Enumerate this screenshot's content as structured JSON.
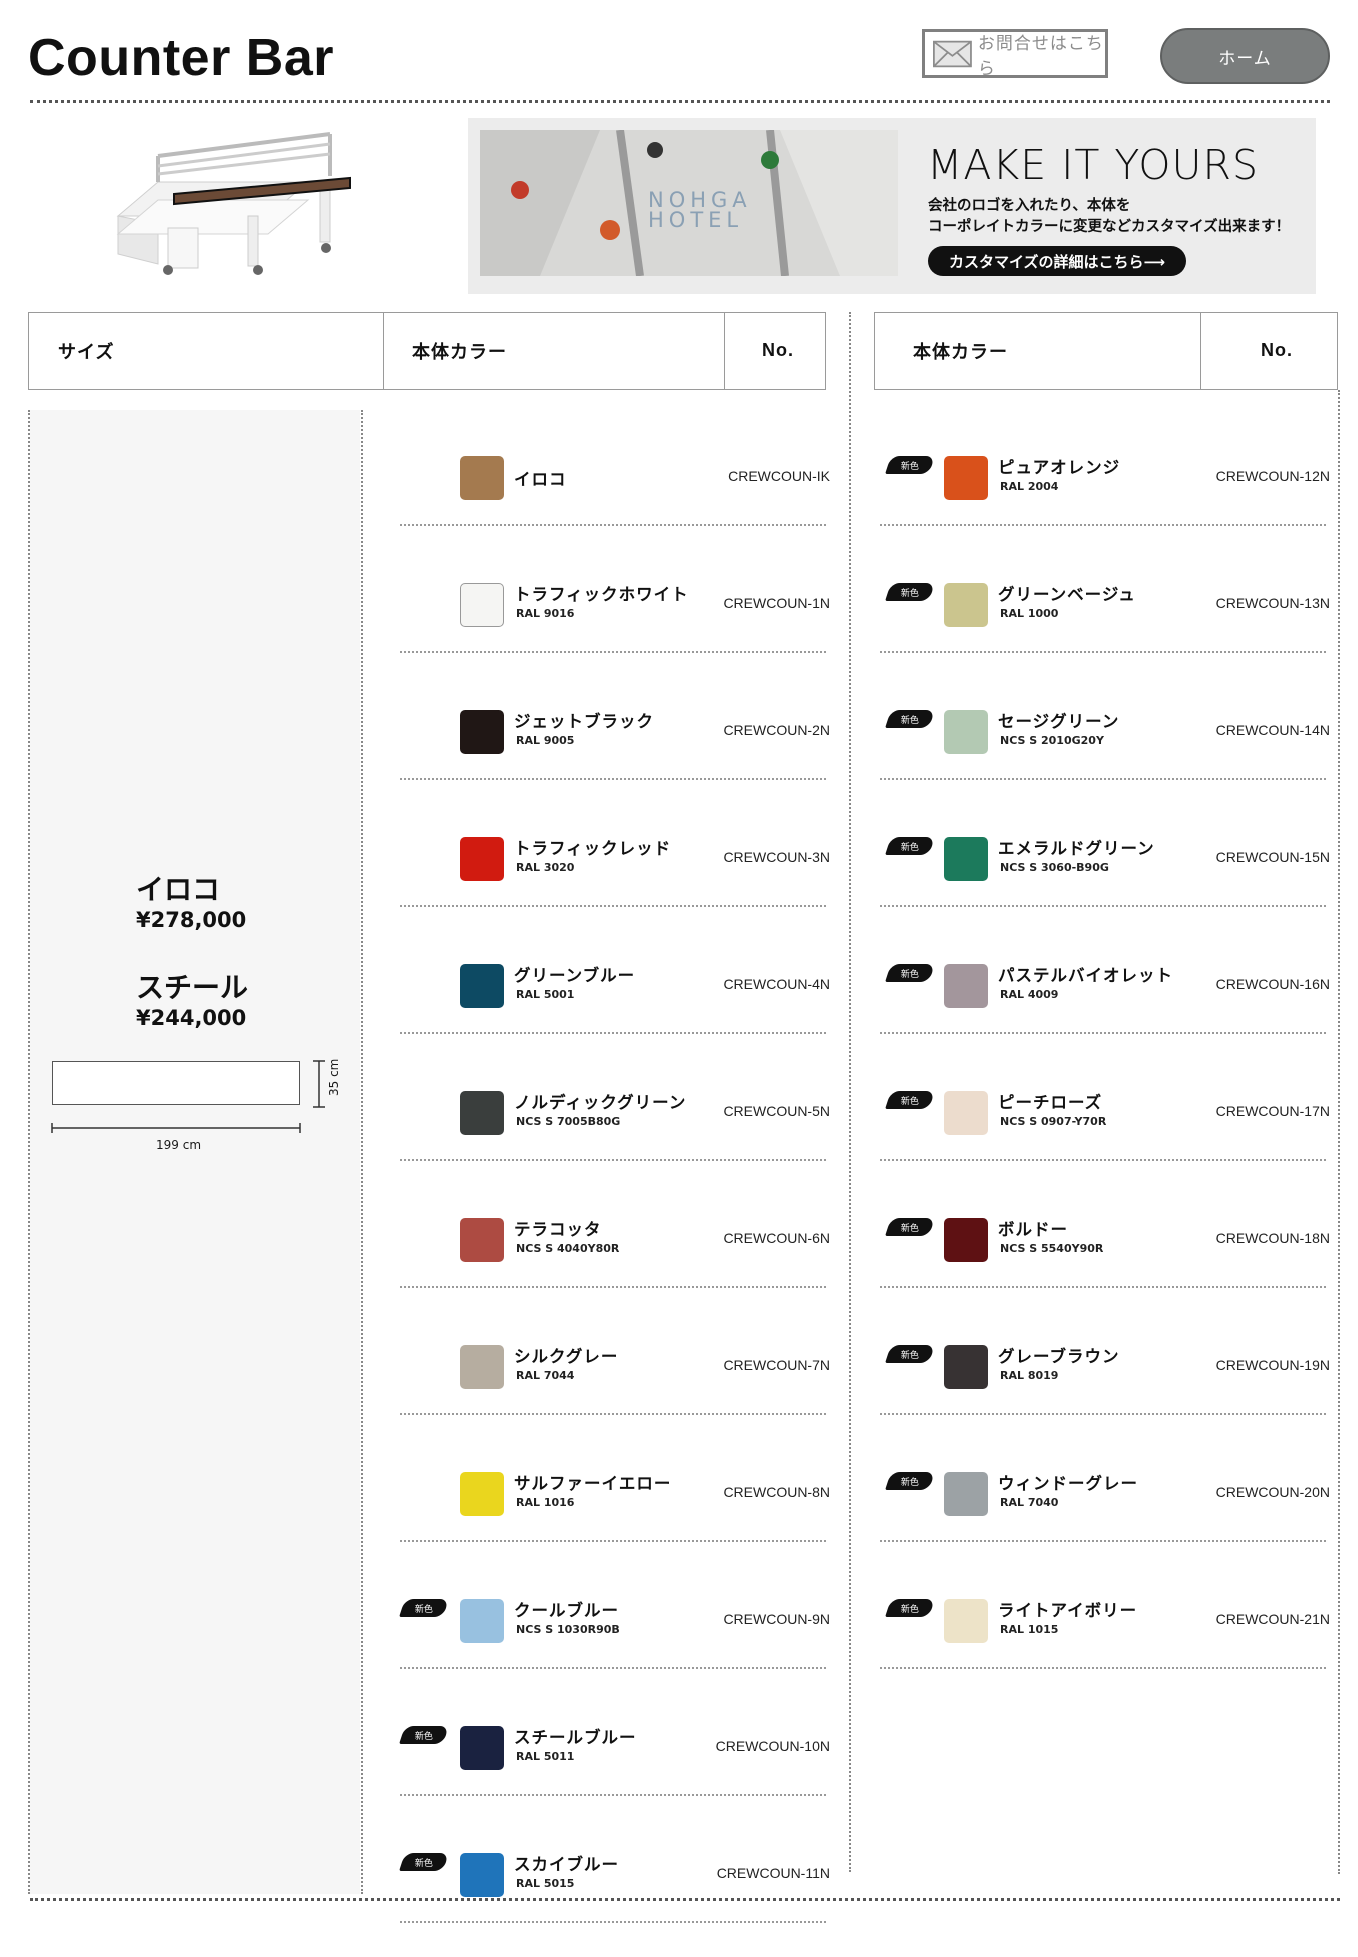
{
  "header": {
    "title": "Counter Bar",
    "contact_label": "お問合せはこちら",
    "home_label": "ホーム"
  },
  "banner": {
    "headline": "MAKE IT YOURS",
    "sub1": "会社のロゴを入れたり、本体を",
    "sub2": "コーポレイトカラーに変更などカスタマイズ出来ます！",
    "cta": "カスタマイズの詳細はこちら⟶",
    "photo_text1": "NOHGA",
    "photo_text2": "HOTEL"
  },
  "table": {
    "size_header": "サイズ",
    "color_header": "本体カラー",
    "no_header": "No.",
    "color_header_right": "本体カラー",
    "no_header_right": "No."
  },
  "sizes": {
    "name1": "イロコ",
    "price1": "¥278,000",
    "name2": "スチール",
    "price2": "¥244,000",
    "depth": "35 cm",
    "width": "199 cm"
  },
  "new_badge": "新色",
  "colors_left": [
    {
      "name": "イロコ",
      "code": "",
      "no": "CREWCOUN-IK",
      "hex": "#a47a4f",
      "is_new": false
    },
    {
      "name": "トラフィックホワイト",
      "code": "RAL 9016",
      "no": "CREWCOUN-1N",
      "hex": "#f5f5f3",
      "is_new": false
    },
    {
      "name": "ジェットブラック",
      "code": "RAL 9005",
      "no": "CREWCOUN-2N",
      "hex": "#201715",
      "is_new": false
    },
    {
      "name": "トラフィックレッド",
      "code": "RAL 3020",
      "no": "CREWCOUN-3N",
      "hex": "#d11b10",
      "is_new": false
    },
    {
      "name": "グリーンブルー",
      "code": "RAL 5001",
      "no": "CREWCOUN-4N",
      "hex": "#0d4a63",
      "is_new": false
    },
    {
      "name": "ノルディックグリーン",
      "code": "NCS S 7005B80G",
      "no": "CREWCOUN-5N",
      "hex": "#3a3e3d",
      "is_new": false
    },
    {
      "name": "テラコッタ",
      "code": "NCS S 4040Y80R",
      "no": "CREWCOUN-6N",
      "hex": "#ad4b42",
      "is_new": false
    },
    {
      "name": "シルクグレー",
      "code": "RAL 7044",
      "no": "CREWCOUN-7N",
      "hex": "#b6ada0",
      "is_new": false
    },
    {
      "name": "サルファーイエロー",
      "code": "RAL 1016",
      "no": "CREWCOUN-8N",
      "hex": "#ead61e",
      "is_new": false
    },
    {
      "name": "クールブルー",
      "code": "NCS S 1030R90B",
      "no": "CREWCOUN-9N",
      "hex": "#98c1e0",
      "is_new": true
    },
    {
      "name": "スチールブルー",
      "code": "RAL 5011",
      "no": "CREWCOUN-10N",
      "hex": "#1a2240",
      "is_new": true
    },
    {
      "name": "スカイブルー",
      "code": "RAL 5015",
      "no": "CREWCOUN-11N",
      "hex": "#1f74ba",
      "is_new": true
    }
  ],
  "colors_right": [
    {
      "name": "ピュアオレンジ",
      "code": "RAL 2004",
      "no": "CREWCOUN-12N",
      "hex": "#d9511b",
      "is_new": true
    },
    {
      "name": "グリーンベージュ",
      "code": "RAL 1000",
      "no": "CREWCOUN-13N",
      "hex": "#cbc58e",
      "is_new": true
    },
    {
      "name": "セージグリーン",
      "code": "NCS S 2010G20Y",
      "no": "CREWCOUN-14N",
      "hex": "#b3c9b3",
      "is_new": true
    },
    {
      "name": "エメラルドグリーン",
      "code": "NCS S 3060-B90G",
      "no": "CREWCOUN-15N",
      "hex": "#1c7a5c",
      "is_new": true
    },
    {
      "name": "パステルバイオレット",
      "code": "RAL 4009",
      "no": "CREWCOUN-16N",
      "hex": "#a3969c",
      "is_new": true
    },
    {
      "name": "ピーチローズ",
      "code": "NCS S 0907-Y70R",
      "no": "CREWCOUN-17N",
      "hex": "#ecdccd",
      "is_new": true
    },
    {
      "name": "ボルドー",
      "code": "NCS S 5540Y90R",
      "no": "CREWCOUN-18N",
      "hex": "#5e1113",
      "is_new": true
    },
    {
      "name": "グレーブラウン",
      "code": "RAL 8019",
      "no": "CREWCOUN-19N",
      "hex": "#373233",
      "is_new": true
    },
    {
      "name": "ウィンドーグレー",
      "code": "RAL 7040",
      "no": "CREWCOUN-20N",
      "hex": "#9ca2a5",
      "is_new": true
    },
    {
      "name": "ライトアイボリー",
      "code": "RAL 1015",
      "no": "CREWCOUN-21N",
      "hex": "#ede3c8",
      "is_new": true
    }
  ]
}
